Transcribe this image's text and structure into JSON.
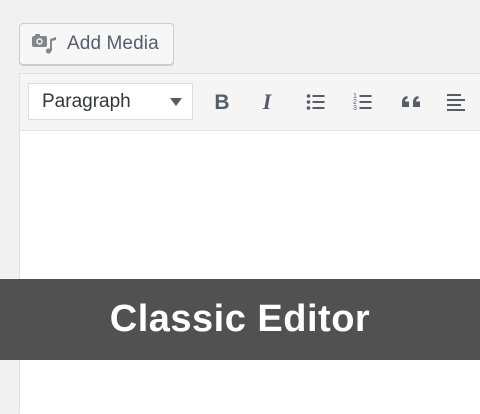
{
  "toolbar_top": {
    "add_media_label": "Add Media",
    "add_media_icon": "media-camera-music-icon"
  },
  "editor": {
    "format_select": {
      "selected": "Paragraph"
    },
    "buttons": [
      {
        "name": "bold-button",
        "icon": "bold-icon",
        "glyph": "B"
      },
      {
        "name": "italic-button",
        "icon": "italic-icon",
        "glyph": "I"
      },
      {
        "name": "bulleted-list-button",
        "icon": "bulleted-list-icon"
      },
      {
        "name": "numbered-list-button",
        "icon": "numbered-list-icon"
      },
      {
        "name": "blockquote-button",
        "icon": "blockquote-icon"
      },
      {
        "name": "align-left-button",
        "icon": "align-left-icon"
      }
    ],
    "content": ""
  },
  "banner": {
    "title": "Classic Editor"
  },
  "colors": {
    "page_bg": "#f1f1f1",
    "toolbar_bg": "#f5f5f5",
    "icon": "#555d66",
    "banner_bg": "#464646",
    "banner_text": "#ffffff"
  }
}
